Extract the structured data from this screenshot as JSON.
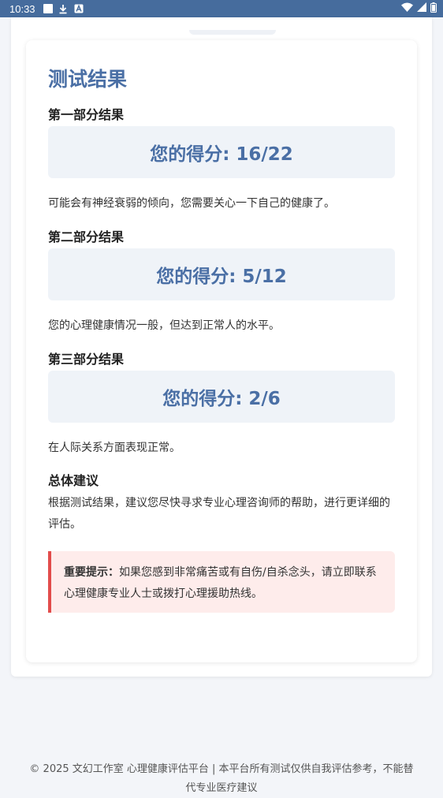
{
  "status_bar": {
    "time": "10:33"
  },
  "result": {
    "title": "测试结果",
    "sections": [
      {
        "heading": "第一部分结果",
        "score": "您的得分: 16/22",
        "description": "可能会有神经衰弱的倾向，您需要关心一下自己的健康了。"
      },
      {
        "heading": "第二部分结果",
        "score": "您的得分: 5/12",
        "description": "您的心理健康情况一般，但达到正常人的水平。"
      },
      {
        "heading": "第三部分结果",
        "score": "您的得分: 2/6",
        "description": "在人际关系方面表现正常。"
      }
    ],
    "advice_heading": "总体建议",
    "advice_text": "根据测试结果，建议您尽快寻求专业心理咨询师的帮助，进行更详细的评估。",
    "warning_label": "重要提示：",
    "warning_text": "如果您感到非常痛苦或有自伤/自杀念头，请立即联系心理健康专业人士或拨打心理援助热线。"
  },
  "footer": {
    "text": "© 2025 文幻工作室 心理健康评估平台 | 本平台所有测试仅供自我评估参考，不能替代专业医疗建议"
  },
  "colors": {
    "status_bar": "#466c9d",
    "accent": "#4a6fa5",
    "warning_border": "#e24c4b",
    "warning_bg": "#feeceb"
  }
}
